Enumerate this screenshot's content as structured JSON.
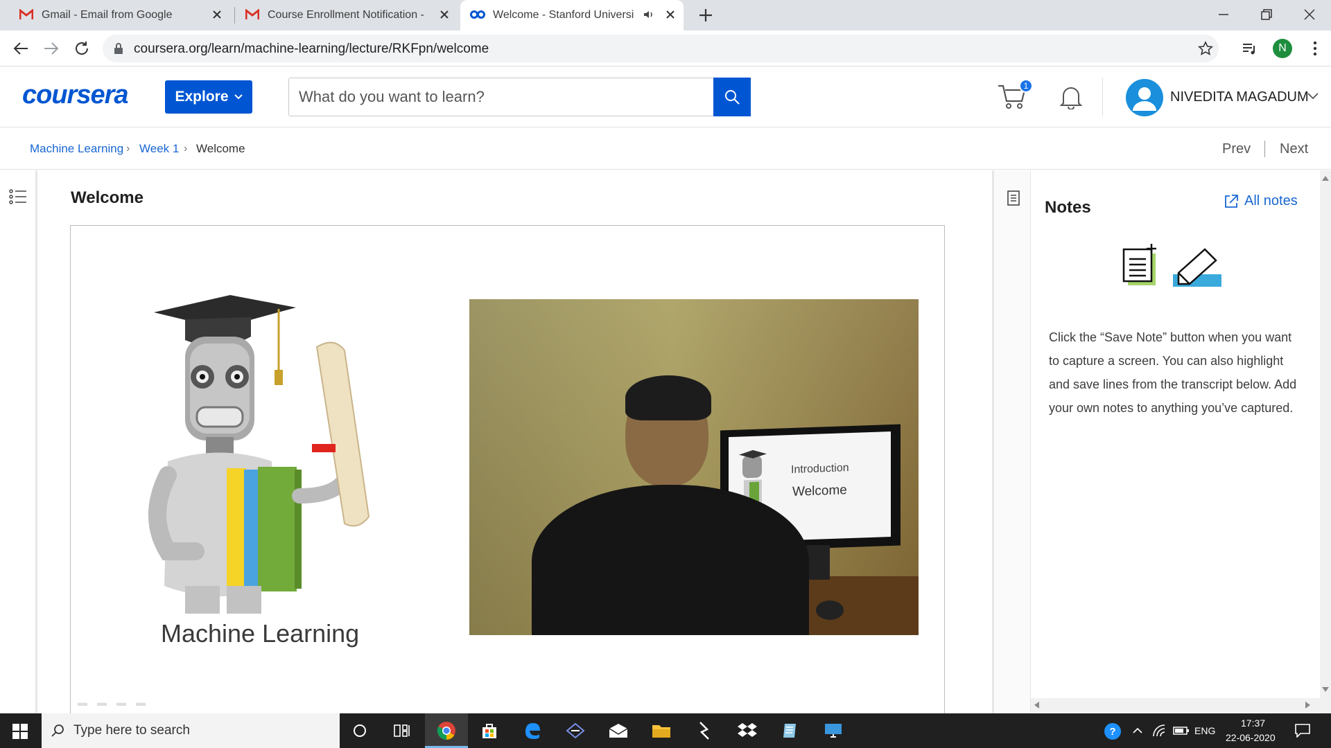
{
  "browser": {
    "tabs": [
      {
        "title": "Gmail - Email from Google"
      },
      {
        "title": "Course Enrollment Notification - "
      },
      {
        "title": "Welcome - Stanford Universi"
      }
    ],
    "url": "coursera.org/learn/machine-learning/lecture/RKFpn/welcome",
    "profile_initial": "N"
  },
  "header": {
    "logo": "coursera",
    "explore_label": "Explore",
    "search_placeholder": "What do you want to learn?",
    "cart_count": "1",
    "user_name": "NIVEDITA MAGADUM"
  },
  "breadcrumb": {
    "items": [
      "Machine Learning",
      "Week 1",
      "Welcome"
    ],
    "prev": "Prev",
    "next": "Next"
  },
  "main": {
    "title": "Welcome",
    "slide_caption": "Machine Learning",
    "monitor_line1": "Introduction",
    "monitor_line2": "Welcome"
  },
  "notes": {
    "title": "Notes",
    "all_notes": "All notes",
    "description": "Click the “Save Note” button when you want to capture a screen. You can also highlight and save lines from the transcript below. Add your own notes to anything you’ve captured."
  },
  "taskbar": {
    "search_placeholder": "Type here to search",
    "language": "ENG",
    "time": "17:37",
    "date": "22-06-2020"
  },
  "colors": {
    "brand": "#0056d2",
    "link": "#1967d2",
    "taskbar": "#202020"
  }
}
